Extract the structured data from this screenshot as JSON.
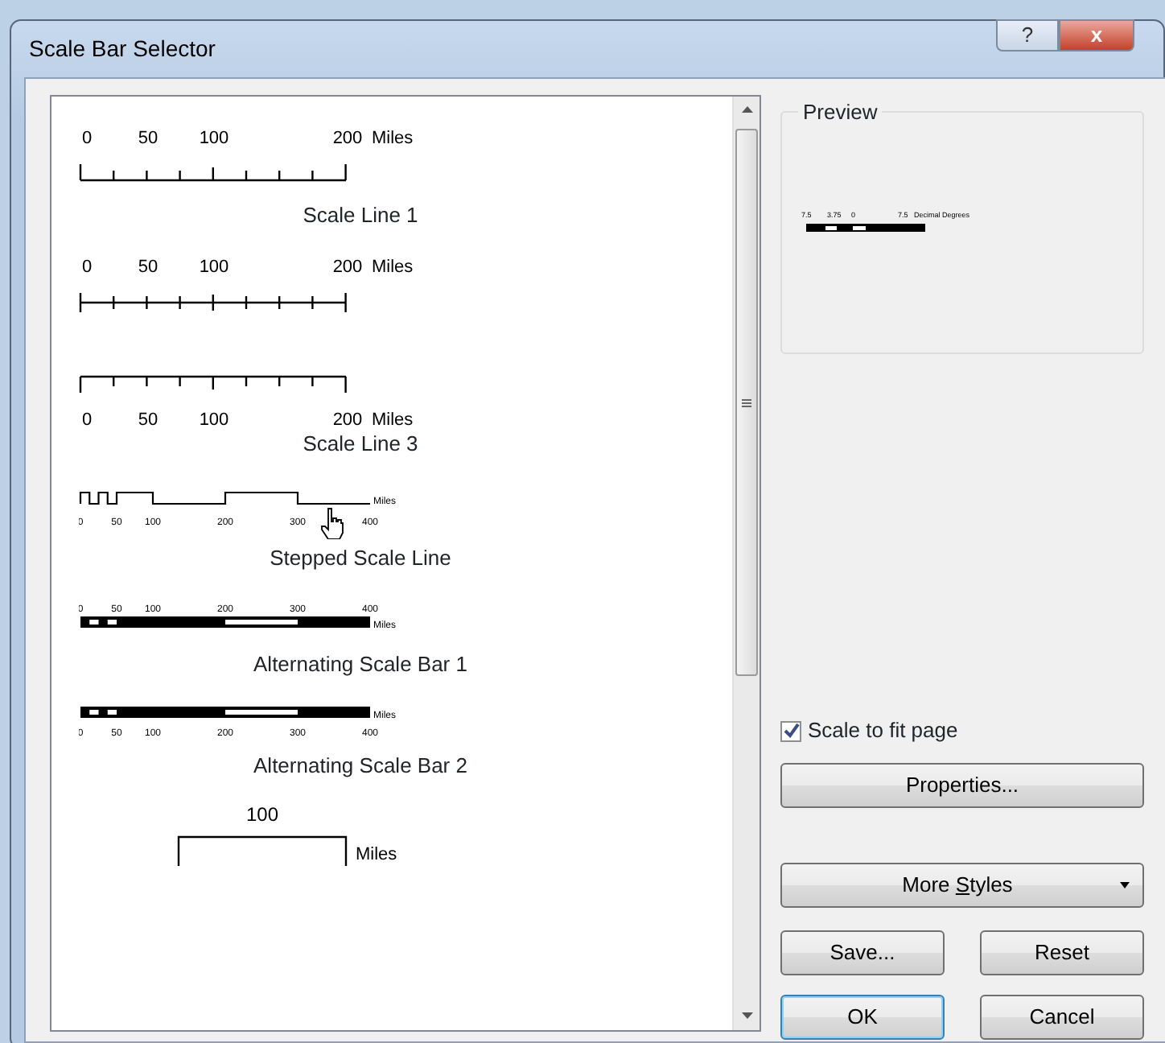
{
  "window": {
    "title": "Scale Bar Selector",
    "help_button": "?",
    "close_button": "x"
  },
  "styles": [
    {
      "kind": "line_down",
      "labels": [
        "0",
        "50",
        "100",
        "200"
      ],
      "unit": "Miles",
      "name": "Scale Line 1",
      "selected": false
    },
    {
      "kind": "line_center",
      "labels": [
        "0",
        "50",
        "100",
        "200"
      ],
      "unit": "Miles",
      "selected": false
    },
    {
      "kind": "line_up",
      "labels": [
        "0",
        "50",
        "100",
        "200"
      ],
      "unit": "Miles",
      "name": "Scale Line 3",
      "selected": false
    },
    {
      "kind": "stepped",
      "labels": [
        "0",
        "50",
        "100",
        "200",
        "300",
        "400"
      ],
      "unit": "Miles",
      "name": "Stepped Scale Line",
      "selected": false
    },
    {
      "kind": "alternating_1",
      "labels": [
        "0",
        "50",
        "100",
        "200",
        "300",
        "400"
      ],
      "unit": "Miles",
      "name": "Alternating Scale Bar 1",
      "selected": false
    },
    {
      "kind": "alternating_2",
      "labels": [
        "0",
        "50",
        "100",
        "200",
        "300",
        "400"
      ],
      "unit": "Miles",
      "name": "Alternating Scale Bar 2",
      "selected": false
    },
    {
      "kind": "single_box",
      "labels": [
        "100"
      ],
      "unit": "Miles",
      "selected": false
    }
  ],
  "preview": {
    "title": "Preview",
    "labels": [
      "7.5",
      "3.75",
      "0",
      "7.5"
    ],
    "unit": "Decimal Degrees"
  },
  "scale_to_fit": {
    "label": "Scale to fit page",
    "checked": true
  },
  "buttons": [
    {
      "label": "Properties...",
      "kind": "wide"
    },
    {
      "label": "More **S**tyles",
      "kind": "dropdown"
    },
    {
      "label": "Save...",
      "kind": "half"
    },
    {
      "label": "Reset",
      "kind": "half"
    },
    {
      "label": "OK",
      "kind": "default"
    },
    {
      "label": "Cancel",
      "kind": "half"
    }
  ]
}
